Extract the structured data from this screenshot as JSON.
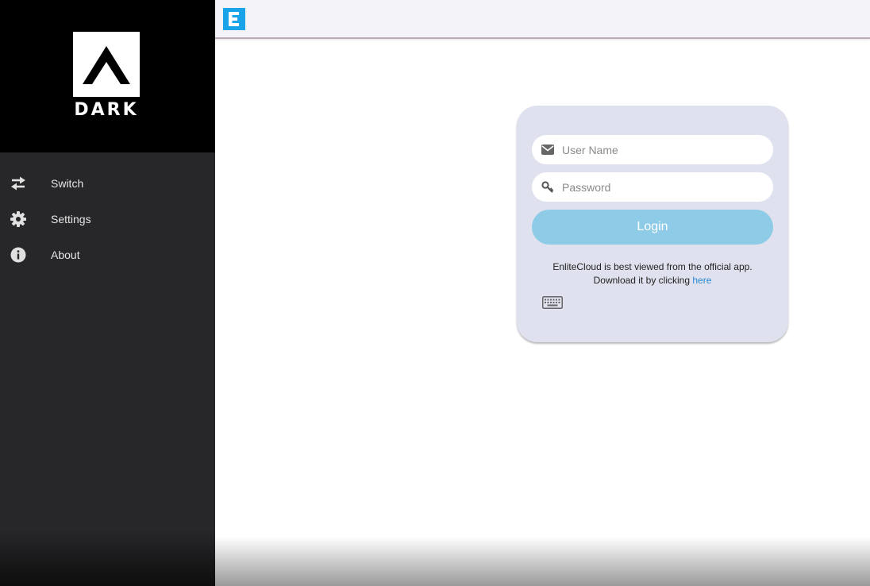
{
  "sidebar": {
    "logo_text": "DARK",
    "items": [
      {
        "label": "Switch",
        "icon": "switch-arrows-icon"
      },
      {
        "label": "Settings",
        "icon": "gear-icon"
      },
      {
        "label": "About",
        "icon": "info-icon"
      }
    ]
  },
  "header": {
    "app_icon_letter": "E",
    "app_icon_color": "#1aa3e8"
  },
  "login": {
    "username_placeholder": "User Name",
    "password_placeholder": "Password",
    "login_label": "Login",
    "note_line1": "EnliteCloud is best viewed from the official app.",
    "note_line2": "Download it by clicking",
    "link_text": "here",
    "button_color": "#8dcbe6",
    "link_color": "#2a88d0"
  }
}
